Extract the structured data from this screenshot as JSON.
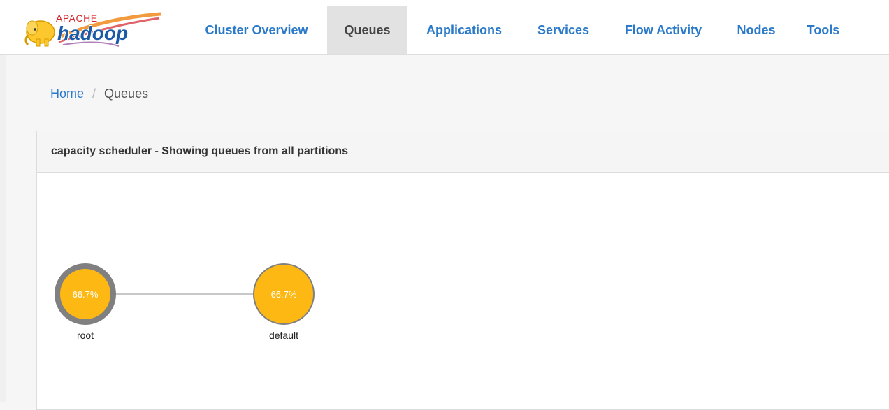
{
  "logo": {
    "top_text": "APACHE",
    "main_text": "hadoop"
  },
  "nav": {
    "tabs": [
      {
        "label": "Cluster Overview",
        "active": false
      },
      {
        "label": "Queues",
        "active": true
      },
      {
        "label": "Applications",
        "active": false
      },
      {
        "label": "Services",
        "active": false
      },
      {
        "label": "Flow Activity",
        "active": false
      },
      {
        "label": "Nodes",
        "active": false
      },
      {
        "label": "Tools",
        "active": false
      }
    ]
  },
  "breadcrumb": {
    "home": "Home",
    "separator": "/",
    "current": "Queues"
  },
  "panel": {
    "title": "capacity scheduler - Showing queues from all partitions"
  },
  "queues": [
    {
      "name": "root",
      "usage": "66.7%",
      "ring_color": "#808080"
    },
    {
      "name": "default",
      "usage": "66.7%",
      "ring_color": "#808080"
    }
  ],
  "colors": {
    "accent": "#2b7ac9",
    "node_fill": "#fdb813",
    "edge": "#c8c8c8"
  }
}
